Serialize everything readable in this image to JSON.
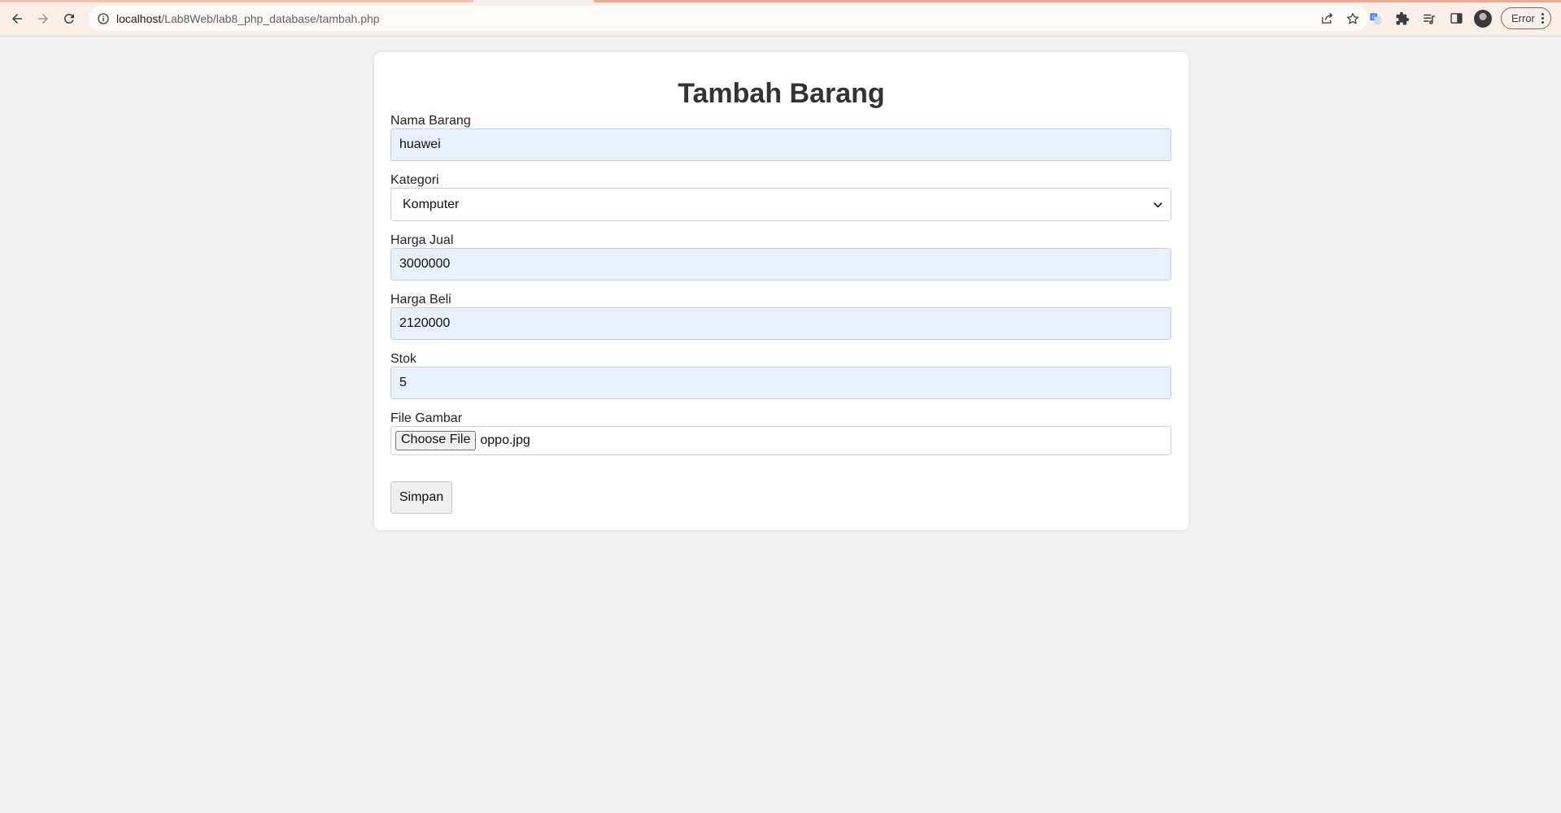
{
  "browser": {
    "url_host": "localhost",
    "url_path": "/Lab8Web/lab8_php_database/tambah.php",
    "profile_status": "Error",
    "icons": [
      "back-icon",
      "forward-icon",
      "reload-icon",
      "site-info-icon",
      "share-icon",
      "bookmark-star-icon",
      "translate-icon",
      "extensions-icon",
      "reading-list-icon",
      "side-panel-icon",
      "avatar",
      "kebab-menu-icon"
    ]
  },
  "form": {
    "title": "Tambah Barang",
    "fields": {
      "nama": {
        "label": "Nama Barang",
        "value": "huawei"
      },
      "kategori": {
        "label": "Kategori",
        "value": "Komputer"
      },
      "harga_jual": {
        "label": "Harga Jual",
        "value": "3000000"
      },
      "harga_beli": {
        "label": "Harga Beli",
        "value": "2120000"
      },
      "stok": {
        "label": "Stok",
        "value": "5"
      },
      "gambar": {
        "label": "File Gambar",
        "button": "Choose File",
        "filename": "oppo.jpg"
      }
    },
    "submit_label": "Simpan"
  },
  "colors": {
    "page_bg": "#f2f2f2",
    "toolbar_bg": "#f8efe9",
    "autofill_bg": "#e8f0fe",
    "title": "#333333"
  }
}
